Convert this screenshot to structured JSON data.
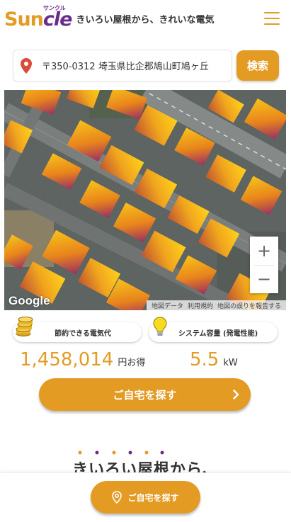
{
  "header": {
    "logo_main": "Sun",
    "logo_accent": "cle",
    "logo_ruby": "サンクル",
    "tagline": "きいろい屋根から、きれいな電気",
    "menu_icon": "hamburger-menu-icon"
  },
  "search": {
    "value": "〒350-0312 埼玉県比企郡鳩山町鳩ヶ丘",
    "button_label": "検索",
    "icon": "location-pin-icon"
  },
  "map": {
    "google_label": "Google",
    "attribution": [
      "地図データ",
      "利用規約",
      "地図の誤りを報告する"
    ],
    "zoom_in": "+",
    "zoom_out": "−"
  },
  "stats": {
    "savings_label": "節約できる電気代",
    "savings_value": "1,458,014",
    "savings_unit": "円お得",
    "system_label": "システム容量 (発電性能)",
    "system_value": "5.5",
    "system_unit": "kW",
    "savings_icon": "coins-icon",
    "system_icon": "lightbulb-icon"
  },
  "cta": {
    "main_label": "ご自宅を探す",
    "bottom_label": "ご自宅を探す"
  },
  "section": {
    "heading": "きいろい屋根から、"
  },
  "colors": {
    "brand_orange": "#e39b24",
    "brand_purple": "#6a2c8a"
  }
}
